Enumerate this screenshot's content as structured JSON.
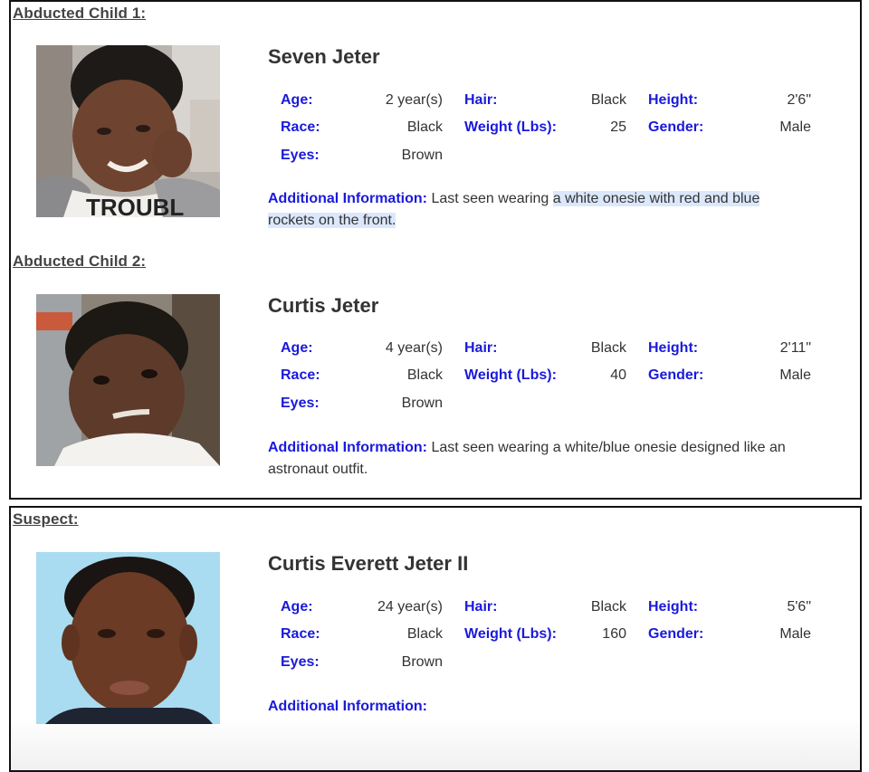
{
  "colors": {
    "label_blue": "#1a1adb",
    "value_text": "#333333",
    "heading_text": "#444444",
    "highlight": "#dbe7fb",
    "suspect_photo_bg": "#a9dcf0"
  },
  "labels": {
    "age": "Age:",
    "race": "Race:",
    "eyes": "Eyes:",
    "hair": "Hair:",
    "weight": "Weight (Lbs):",
    "height": "Height:",
    "gender": "Gender:",
    "additional_info": "Additional Information:"
  },
  "child1": {
    "heading": "Abducted Child 1:",
    "photo": "photo-of-child-seven-jeter",
    "name": "Seven Jeter",
    "age": "2 year(s)",
    "race": "Black",
    "eyes": "Brown",
    "hair": "Black",
    "weight": "25",
    "height": "2'6\"",
    "gender": "Male",
    "additional_info_plain": "Last seen wearing ",
    "additional_info_highlighted_1": "a white onesie with red and blue",
    "additional_info_highlighted_2": "rockets on the front."
  },
  "child2": {
    "heading": "Abducted Child 2:",
    "photo": "photo-of-child-curtis-jeter",
    "name": "Curtis Jeter",
    "age": "4 year(s)",
    "race": "Black",
    "eyes": "Brown",
    "hair": "Black",
    "weight": "40",
    "height": "2'11\"",
    "gender": "Male",
    "additional_info": "Last seen wearing a white/blue onesie designed like an astronaut outfit."
  },
  "suspect": {
    "heading": "Suspect:",
    "photo": "photo-of-suspect-curtis-everett-jeter-ii",
    "name": "Curtis Everett Jeter II",
    "age": "24 year(s)",
    "race": "Black",
    "eyes": "Brown",
    "hair": "Black",
    "weight": "160",
    "height": "5'6\"",
    "gender": "Male",
    "additional_info": ""
  }
}
